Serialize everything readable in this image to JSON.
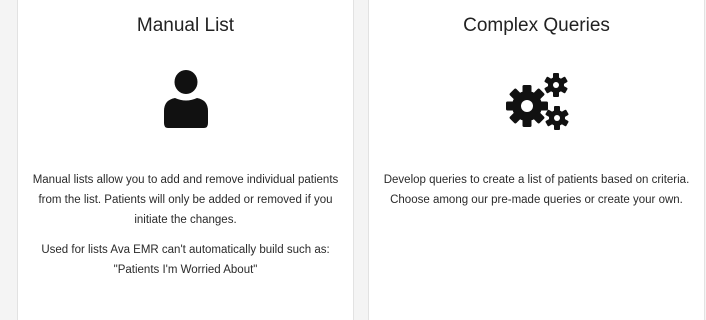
{
  "cards": {
    "manual": {
      "title": "Manual List",
      "icon": "user-icon",
      "description": "Manual lists allow you to add and remove individual patients from the list. Patients will only be added or removed if you initiate the changes.",
      "note": "Used for lists Ava EMR can't automatically build such as: \"Patients I'm Worried About\""
    },
    "complex": {
      "title": "Complex Queries",
      "icon": "gears-icon",
      "description": "Develop queries to create a list of patients based on criteria. Choose among our pre-made queries or create your own."
    }
  },
  "colors": {
    "icon": "#111111",
    "card_background": "#ffffff",
    "page_background": "#f4f4f4"
  }
}
